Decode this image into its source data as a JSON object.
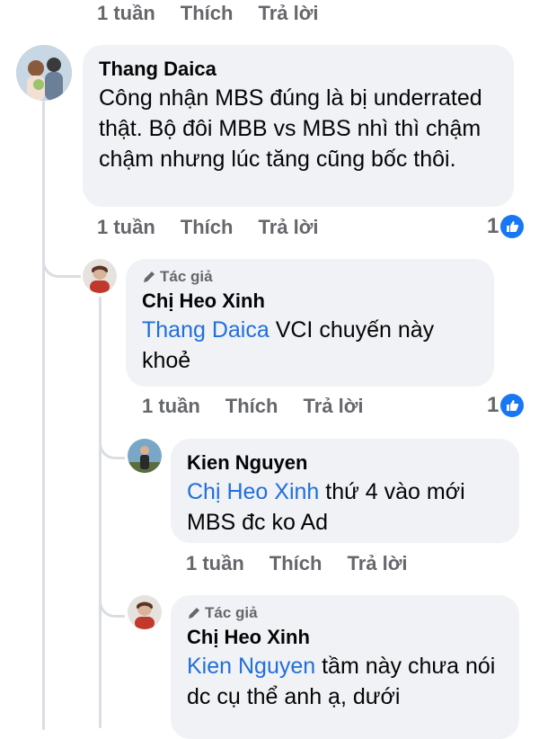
{
  "top_actions": {
    "time": "1 tuần",
    "like": "Thích",
    "reply": "Trả lời"
  },
  "comments": [
    {
      "author": "Thang Daica",
      "text": "Công nhận MBS đúng là bị underrated thật. Bộ đôi MBB vs MBS nhì thì chậm chậm nhưng lúc tăng cũng bốc thôi.",
      "time": "1 tuần",
      "like": "Thích",
      "reply": "Trả lời",
      "reactions": "1"
    },
    {
      "author_tag": "Tác giả",
      "author": "Chị Heo Xinh",
      "mention": "Thang Daica",
      "text": " VCI chuyến này khoẻ",
      "time": "1 tuần",
      "like": "Thích",
      "reply": "Trả lời",
      "reactions": "1"
    },
    {
      "author": "Kien Nguyen",
      "mention": "Chị Heo Xinh",
      "text": " thứ 4 vào mới MBS đc ko Ad",
      "time": "1 tuần",
      "like": "Thích",
      "reply": "Trả lời"
    },
    {
      "author_tag": "Tác giả",
      "author": "Chị Heo Xinh",
      "mention": "Kien Nguyen",
      "text": " tầm này chưa nói dc cụ thể anh ạ, dưới"
    }
  ],
  "colors": {
    "bubble": "#f0f2f5",
    "mention": "#216fdb",
    "like": "#1877f2",
    "meta": "#65676b"
  }
}
